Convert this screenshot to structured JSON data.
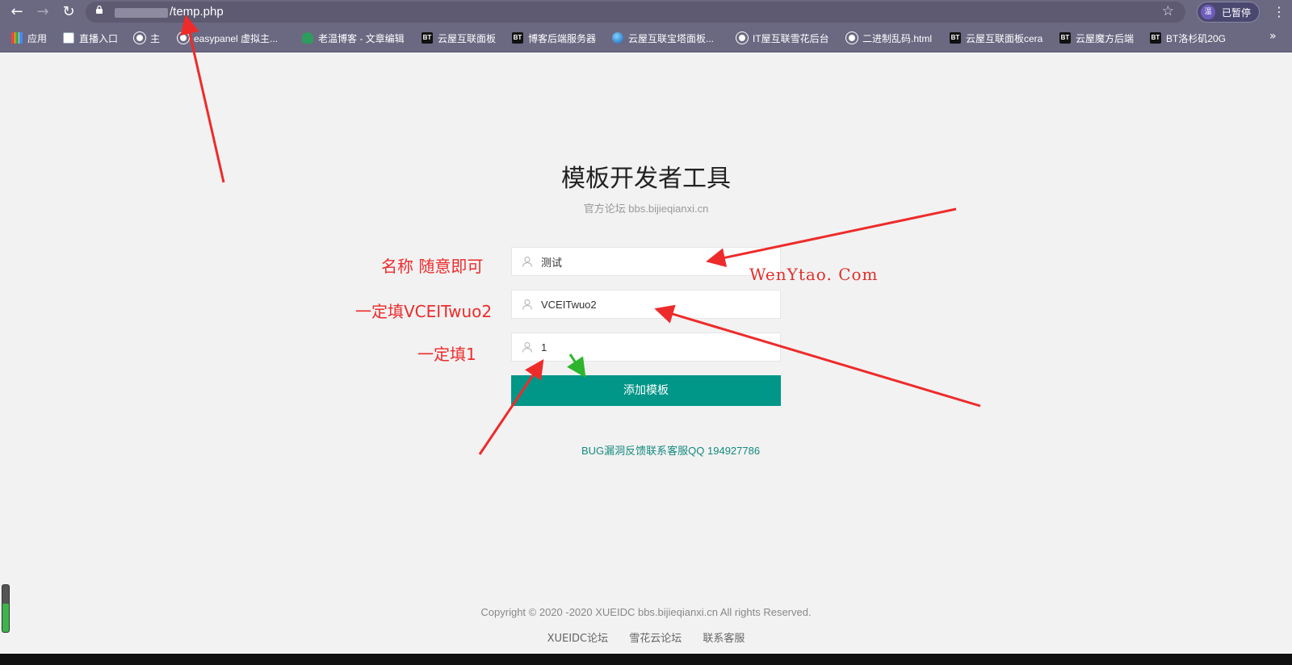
{
  "browser": {
    "address_path": "/temp.php",
    "profile_avatar": "温",
    "profile_label": "已暂停",
    "bookmarks": [
      {
        "label": "应用",
        "icon": "apps-grid-icon"
      },
      {
        "label": "直播入口",
        "icon": "document-icon"
      },
      {
        "label": "主",
        "icon": "globe-icon"
      },
      {
        "label": "easypanel 虚拟主...",
        "icon": "globe-icon"
      },
      {
        "label": "老温博客 - 文章编辑",
        "icon": "tree-icon"
      },
      {
        "label": "云屋互联面板",
        "icon": "bt-icon"
      },
      {
        "label": "博客后端服务器",
        "icon": "bt-icon"
      },
      {
        "label": "云屋互联宝塔面板...",
        "icon": "ball-icon"
      },
      {
        "label": "IT屋互联雪花后台",
        "icon": "globe-icon"
      },
      {
        "label": "二进制乱码.html",
        "icon": "globe-icon"
      },
      {
        "label": "云屋互联面板cera",
        "icon": "bt-icon"
      },
      {
        "label": "云屋魔方后端",
        "icon": "bt-icon"
      },
      {
        "label": "BT洛杉矶20G",
        "icon": "bt-icon"
      }
    ]
  },
  "page": {
    "title": "模板开发者工具",
    "subtitle": "官方论坛 bbs.bijieqianxi.cn",
    "fields": [
      {
        "value": "测试"
      },
      {
        "value": "VCEITwuo2"
      },
      {
        "value": "1"
      }
    ],
    "submit_label": "添加模板",
    "bug_link": "BUG漏洞反馈联系客服QQ 194927786",
    "copyright": "Copyright © 2020 -2020  XUEIDC bbs.bijieqianxi.cn  All rights Reserved.",
    "footer_links": [
      "XUEIDC论坛",
      "雪花云论坛",
      "联系客服"
    ]
  },
  "annotations": {
    "name_hint": "名称 随意即可",
    "key_hint": "一定填VCEITwuo2",
    "num_hint": "一定填1",
    "watermark": "WenYtao. Com",
    "arrow_color": "#ee2b2b",
    "green_arrow_color": "#2db52d"
  }
}
